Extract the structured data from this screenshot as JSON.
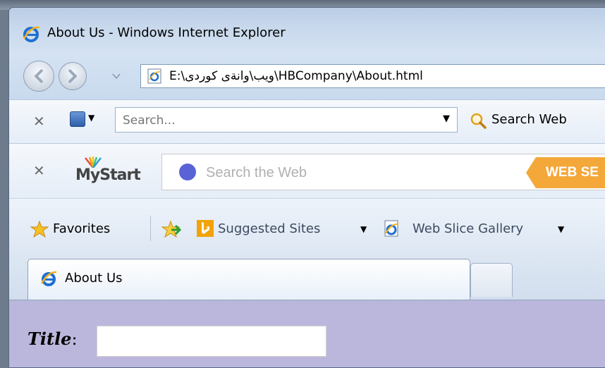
{
  "window": {
    "title": "About Us - Windows Internet Explorer"
  },
  "navigation": {
    "address": "E:\\ویب\\وانةی کوردی\\HBCompany\\About.html"
  },
  "search_toolbar": {
    "search_placeholder": "Search...",
    "search_button_label": "Search Web"
  },
  "mystart_toolbar": {
    "logo_text": "MyStart",
    "search_placeholder": "Search the Web",
    "search_button_label": "WEB SE"
  },
  "favorites_bar": {
    "favorites_label": "Favorites",
    "suggested_sites_label": "Suggested Sites",
    "web_slice_label": "Web Slice Gallery"
  },
  "tabs": [
    {
      "label": "About Us"
    }
  ],
  "page": {
    "title_label": "Title",
    "title_colon": ":",
    "title_value": "",
    "background_color": "#bbb7dc"
  },
  "icons": {
    "browser": "internet-explorer-icon",
    "favorites": "star-icon",
    "search": "magnifier-icon",
    "suggested": "bing-icon"
  }
}
